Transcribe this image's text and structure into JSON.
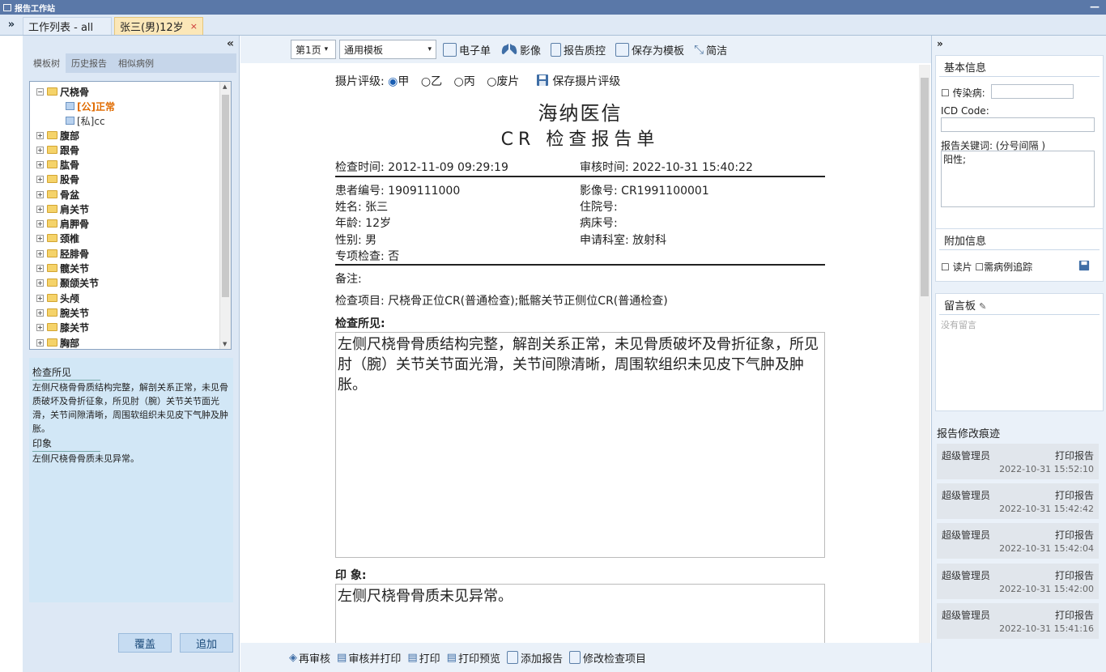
{
  "window": {
    "title": "报告工作站",
    "minimize": "—"
  },
  "tabs": {
    "expand": "»",
    "items": [
      {
        "label": "工作列表 - all"
      },
      {
        "label": "张三(男)12岁",
        "close": "×"
      }
    ]
  },
  "left": {
    "collapse": "«",
    "tabs": [
      "模板树",
      "历史报告",
      "相似病例"
    ],
    "tree": [
      {
        "label": "尺桡骨",
        "toggle": "⊟"
      },
      {
        "label": "[公]正常"
      },
      {
        "label": "[私]cc"
      },
      {
        "label": "腹部",
        "toggle": "⊞"
      },
      {
        "label": "跟骨",
        "toggle": "⊞"
      },
      {
        "label": "肱骨",
        "toggle": "⊞"
      },
      {
        "label": "股骨",
        "toggle": "⊞"
      },
      {
        "label": "骨盆",
        "toggle": "⊞"
      },
      {
        "label": "肩关节",
        "toggle": "⊞"
      },
      {
        "label": "肩胛骨",
        "toggle": "⊞"
      },
      {
        "label": "颈椎",
        "toggle": "⊞"
      },
      {
        "label": "胫腓骨",
        "toggle": "⊞"
      },
      {
        "label": "髋关节",
        "toggle": "⊞"
      },
      {
        "label": "颞颌关节",
        "toggle": "⊞"
      },
      {
        "label": "头颅",
        "toggle": "⊞"
      },
      {
        "label": "腕关节",
        "toggle": "⊞"
      },
      {
        "label": "膝关节",
        "toggle": "⊞"
      },
      {
        "label": "胸部",
        "toggle": "⊞"
      }
    ],
    "preview": {
      "findings_title": "检查所见",
      "findings": "左侧尺桡骨骨质结构完整，解剖关系正常，未见骨质破坏及骨折征象，所见肘（腕）关节关节面光滑，关节间隙清晰，周围软组织未见皮下气肿及肿胀。",
      "impression_title": "印象",
      "impression": "左侧尺桡骨骨质未见异常。"
    },
    "buttons": {
      "overwrite": "覆盖",
      "append": "追加"
    }
  },
  "toolbar": {
    "page": "第1页",
    "template": "通用模板",
    "esheet": "电子单",
    "image": "影像",
    "qc": "报告质控",
    "save_template": "保存为模板",
    "simple": "简洁"
  },
  "report": {
    "rating_label": "摄片评级:",
    "rating_options": [
      "甲",
      "乙",
      "丙",
      "废片"
    ],
    "rating_radio_on": "◉",
    "rating_radio_off": "○",
    "save_rating": "保存摄片评级",
    "hospital": "海纳医信",
    "title": "CR 检查报告单",
    "exam_time": "检查时间: 2012-11-09 09:29:19",
    "audit_time": "审核时间: 2022-10-31 15:40:22",
    "patient_no": "患者编号: 1909111000",
    "image_no": "影像号: CR1991100001",
    "name": "姓名: 张三",
    "inpatient_no": "住院号:",
    "age": "年龄: 12岁",
    "bed_no": "病床号:",
    "sex": "性别: 男",
    "dept": "申请科室: 放射科",
    "special": "专项检查: 否",
    "remark": "备注:",
    "items": "检查项目: 尺桡骨正位CR(普通检查);骶髂关节正侧位CR(普通检查)",
    "findings_label": "检查所见:",
    "findings": "左侧尺桡骨骨质结构完整，解剖关系正常，未见骨质破坏及骨折征象，所见肘（腕）关节关节面光滑，关节间隙清晰，周围软组织未见皮下气肿及肿胀。",
    "impression_label": "印 象:",
    "impression": "左侧尺桡骨骨质未见异常。"
  },
  "bottom_toolbar": {
    "reaudit": "再审核",
    "audit_print": "审核并打印",
    "print": "打印",
    "preview": "打印预览",
    "add_report": "添加报告",
    "modify_items": "修改检查项目"
  },
  "right": {
    "expand": "»",
    "basic_title": "基本信息",
    "infectious": "☐ 传染病:",
    "icd": "ICD Code:",
    "keywords_label": "报告关键词: (分号间隔 )",
    "keywords": "阳性;",
    "extra_title": "附加信息",
    "checks": "☐ 读片 ☐需病例追踪",
    "board_title": "留言板",
    "board_empty": "没有留言",
    "history_title": "报告修改痕迹",
    "history": [
      {
        "user": "超级管理员",
        "action": "打印报告",
        "time": "2022-10-31 15:52:10"
      },
      {
        "user": "超级管理员",
        "action": "打印报告",
        "time": "2022-10-31 15:42:42"
      },
      {
        "user": "超级管理员",
        "action": "打印报告",
        "time": "2022-10-31 15:42:04"
      },
      {
        "user": "超级管理员",
        "action": "打印报告",
        "time": "2022-10-31 15:42:00"
      },
      {
        "user": "超级管理员",
        "action": "打印报告",
        "time": "2022-10-31 15:41:16"
      }
    ]
  },
  "colors": {
    "titlebar": "#5a78a8",
    "accent_tab": "#fbe7b8",
    "leaf_public": "#e06b00"
  }
}
